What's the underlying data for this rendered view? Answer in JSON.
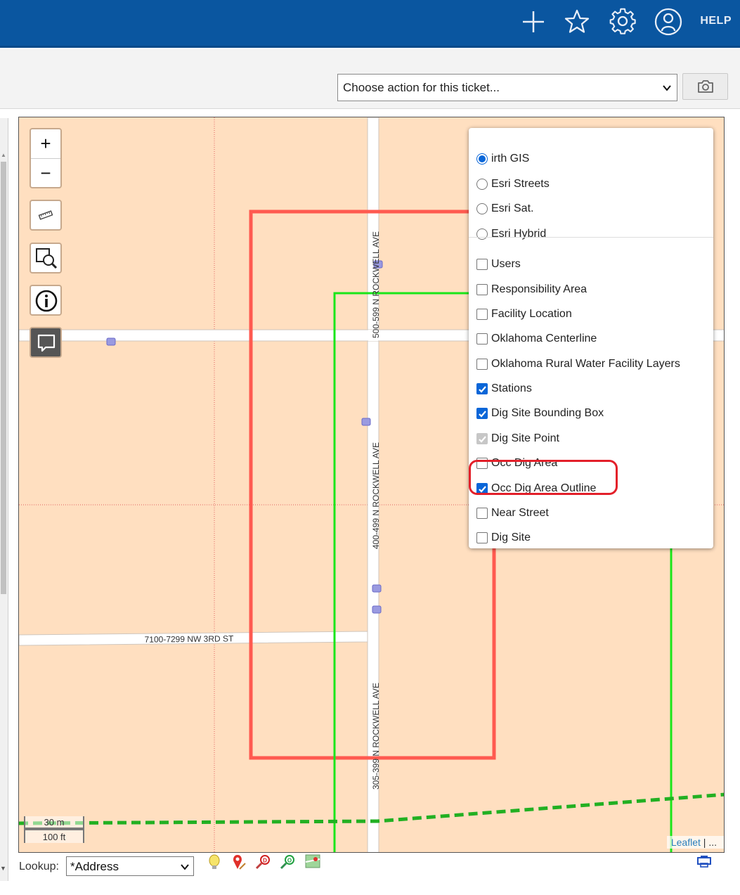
{
  "header": {
    "help_label": "HELP",
    "icons": [
      "plus-icon",
      "star-icon",
      "gear-icon",
      "user-icon"
    ],
    "bg_color": "#0a56a0"
  },
  "toolbar": {
    "action_select_value": "Choose action for this ticket...",
    "camera_icon": "camera-icon"
  },
  "map": {
    "zoom_in_label": "+",
    "zoom_out_label": "−",
    "streets": {
      "rockwell_north": "500-599  N ROCKWELL AVE",
      "rockwell_mid": "400-499  N ROCKWELL AVE",
      "rockwell_south": "305-399  N ROCKWELL AVE",
      "third_st": "7100-7299  NW 3RD ST"
    },
    "scale_metric": "30 m",
    "scale_imperial": "100 ft",
    "attribution_link": "Leaflet",
    "attribution_rest": " | ...",
    "colors": {
      "land": "#ffdfc0",
      "bounding_box": "#ff5a50",
      "dig_outline": "#19e619",
      "dashed_line": "#22b022"
    }
  },
  "layers": {
    "base": [
      {
        "label": "irth GIS",
        "selected": true
      },
      {
        "label": "Esri Streets",
        "selected": false
      },
      {
        "label": "Esri Sat.",
        "selected": false
      },
      {
        "label": "Esri Hybrid",
        "selected": false
      }
    ],
    "overlays": [
      {
        "label": "Users",
        "checked": false
      },
      {
        "label": "Responsibility Area",
        "checked": false
      },
      {
        "label": "Facility Location",
        "checked": false
      },
      {
        "label": "Oklahoma Centerline",
        "checked": false
      },
      {
        "label": "Oklahoma Rural Water Facility Layers",
        "checked": false
      },
      {
        "label": "Stations",
        "checked": true
      },
      {
        "label": "Dig Site Bounding Box",
        "checked": true
      },
      {
        "label": "Dig Site Point",
        "checked": true,
        "disabled": true
      },
      {
        "label": "Occ Dig Area",
        "checked": false
      },
      {
        "label": "Occ Dig Area Outline",
        "checked": true
      },
      {
        "label": "Near Street",
        "checked": false
      },
      {
        "label": "Dig Site",
        "checked": false
      }
    ]
  },
  "bottom": {
    "lookup_label": "Lookup:",
    "lookup_value": "*Address"
  }
}
